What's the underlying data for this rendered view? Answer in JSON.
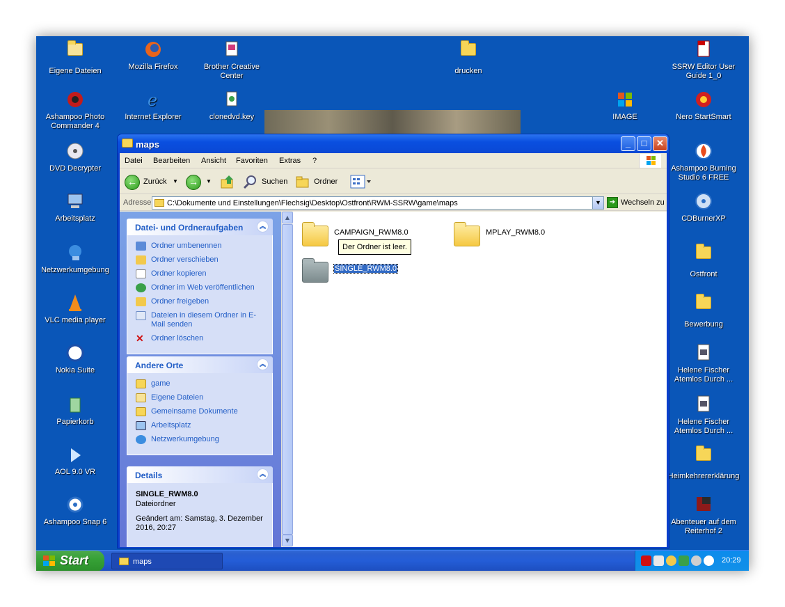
{
  "desktop": {
    "icons": {
      "eigene_dateien": "Eigene Dateien",
      "firefox": "Mozilla Firefox",
      "brother": "Brother Creative Center",
      "drucken": "drucken",
      "ssrw_guide": "SSRW Editor User Guide 1_0",
      "ashampoo_photo": "Ashampoo Photo Commander 4",
      "ie": "Internet Explorer",
      "clonedvd": "clonedvd.key",
      "image": "IMAGE",
      "nero": "Nero StartSmart",
      "dvd_decrypter": "DVD Decrypter",
      "ashampoo_burning": "Ashampoo Burning Studio 6 FREE",
      "arbeitsplatz": "Arbeitsplatz",
      "cdburner": "CDBurnerXP",
      "netzwerk": "Netzwerkumgebung",
      "ostfront": "Ostfront",
      "vlc": "VLC media player",
      "bewerbung": "Bewerbung",
      "nokia": "Nokia Suite",
      "helene1": "Helene Fischer Atemlos Durch ...",
      "papierkorb": "Papierkorb",
      "helene2": "Helene Fischer Atemlos Durch ...",
      "aol": "AOL 9.0 VR",
      "heimkehrer": "Heimkehrererklärung",
      "ashampoo_snap": "Ashampoo Snap 6",
      "abenteuer": "Abenteuer auf dem Reiterhof 2"
    }
  },
  "window": {
    "title": "maps",
    "menu": [
      "Datei",
      "Bearbeiten",
      "Ansicht",
      "Favoriten",
      "Extras",
      "?"
    ],
    "toolbar": {
      "back": "Zurück",
      "search": "Suchen",
      "folders": "Ordner"
    },
    "address": {
      "label": "Adresse",
      "value": "C:\\Dokumente und Einstellungen\\Flechsig\\Desktop\\Ostfront\\RWM-SSRW\\game\\maps",
      "go": "Wechseln zu"
    },
    "tasks": {
      "title": "Datei- und Ordneraufgaben",
      "items": [
        "Ordner umbenennen",
        "Ordner verschieben",
        "Ordner kopieren",
        "Ordner im Web veröffentlichen",
        "Ordner freigeben",
        "Dateien in diesem Ordner in E-Mail senden",
        "Ordner löschen"
      ]
    },
    "places": {
      "title": "Andere Orte",
      "items": [
        "game",
        "Eigene Dateien",
        "Gemeinsame Dokumente",
        "Arbeitsplatz",
        "Netzwerkumgebung"
      ]
    },
    "details": {
      "title": "Details",
      "name": "SINGLE_RWM8.0",
      "type": "Dateiordner",
      "modified": "Geändert am: Samstag, 3. Dezember 2016, 20:27"
    },
    "files": [
      {
        "name": "CAMPAIGN_RWM8.0"
      },
      {
        "name": "MPLAY_RWM8.0"
      },
      {
        "name": "SINGLE_RWM8.0"
      }
    ],
    "tooltip": "Der Ordner ist leer."
  },
  "taskbar": {
    "start": "Start",
    "active_task": "maps",
    "clock": "20:29"
  }
}
